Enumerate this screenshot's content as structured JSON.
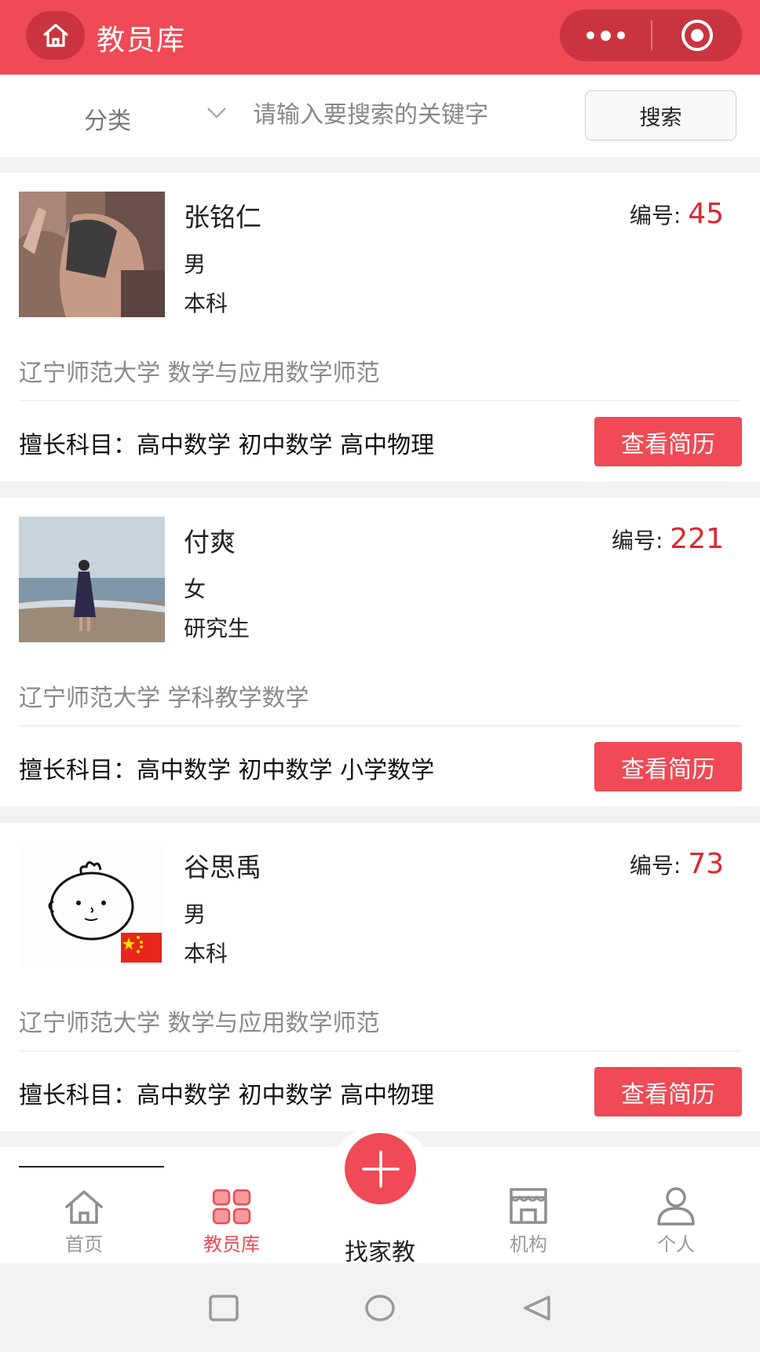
{
  "header": {
    "title": "教员库",
    "icons": {
      "home": "home-icon",
      "more": "more-dots-icon",
      "target": "target-icon"
    }
  },
  "search": {
    "category_label": "分类",
    "placeholder": "请输入要搜索的关键字",
    "value": "",
    "button_label": "搜索"
  },
  "teachers": [
    {
      "name": "张铭仁",
      "id_label": "编号:",
      "id_value": "45",
      "gender": "男",
      "degree": "本科",
      "school": "辽宁师范大学 数学与应用数学师范",
      "subjects": "擅长科目：高中数学 初中数学 高中物理",
      "button_label": "查看简历"
    },
    {
      "name": "付爽",
      "id_label": "编号:",
      "id_value": "221",
      "gender": "女",
      "degree": "研究生",
      "school": "辽宁师范大学 学科教学数学",
      "subjects": "擅长科目：高中数学 初中数学 小学数学",
      "button_label": "查看简历"
    },
    {
      "name": "谷思禹",
      "id_label": "编号:",
      "id_value": "73",
      "gender": "男",
      "degree": "本科",
      "school": "辽宁师范大学 数学与应用数学师范",
      "subjects": "擅长科目：高中数学 初中数学 高中物理",
      "button_label": "查看简历"
    }
  ],
  "tabbar": {
    "items": [
      {
        "label": "首页",
        "icon": "home-icon",
        "active": false
      },
      {
        "label": "教员库",
        "icon": "grid-icon",
        "active": true
      },
      {
        "label": "找家教",
        "icon": "plus-icon",
        "active": false
      },
      {
        "label": "机构",
        "icon": "storefront-icon",
        "active": false
      },
      {
        "label": "个人",
        "icon": "person-icon",
        "active": false
      }
    ]
  },
  "colors": {
    "brand": "#ef4a55",
    "brand_dark": "#c9343f",
    "id_value": "#e0262f",
    "muted_text": "#8a8a8a"
  }
}
